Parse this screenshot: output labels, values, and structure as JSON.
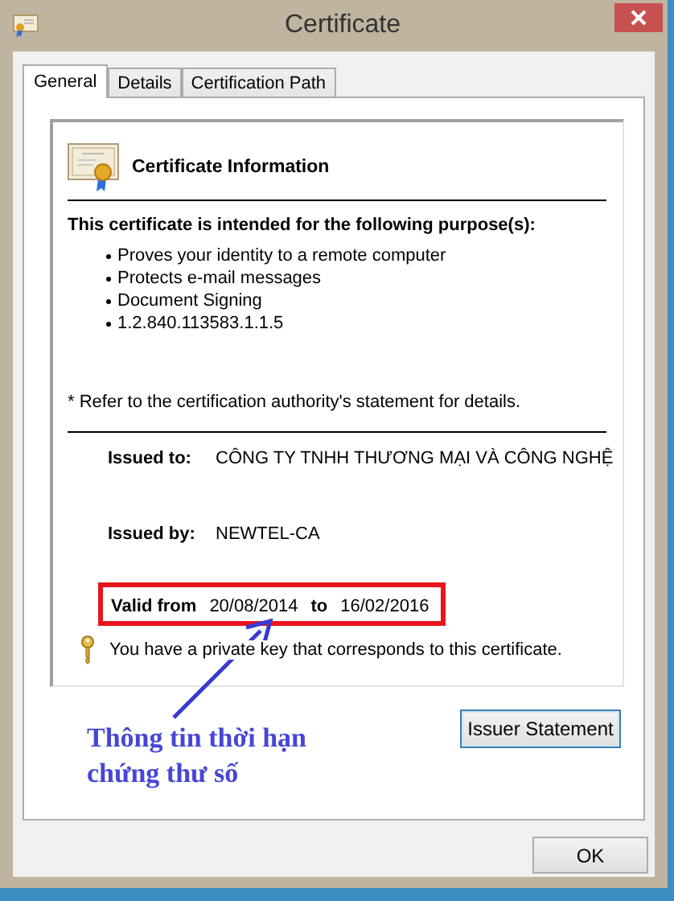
{
  "window": {
    "title": "Certificate"
  },
  "tabs": [
    {
      "label": "General",
      "selected": true
    },
    {
      "label": "Details",
      "selected": false
    },
    {
      "label": "Certification Path",
      "selected": false
    }
  ],
  "info": {
    "heading": "Certificate Information",
    "purpose_heading": "This certificate is intended for the following purpose(s):",
    "purposes": [
      "Proves your identity to a remote computer",
      "Protects e-mail messages",
      "Document Signing",
      "1.2.840.113583.1.1.5"
    ],
    "note": "* Refer to the certification authority's statement for details.",
    "issued_to": {
      "label": "Issued to:",
      "value": "CÔNG TY TNHH THƯƠNG MẠI VÀ CÔNG NGHỆ"
    },
    "issued_by": {
      "label": "Issued by:",
      "value": "NEWTEL-CA"
    },
    "valid": {
      "from_label": "Valid from",
      "from": "20/08/2014",
      "to_label": "to",
      "to": "16/02/2016"
    },
    "private_key_note": "You have a private key that corresponds to this certificate."
  },
  "buttons": {
    "issuer_statement": "Issuer Statement",
    "ok": "OK"
  },
  "annotation": {
    "text": "Thông tin thời hạn\nchứng thư số"
  }
}
